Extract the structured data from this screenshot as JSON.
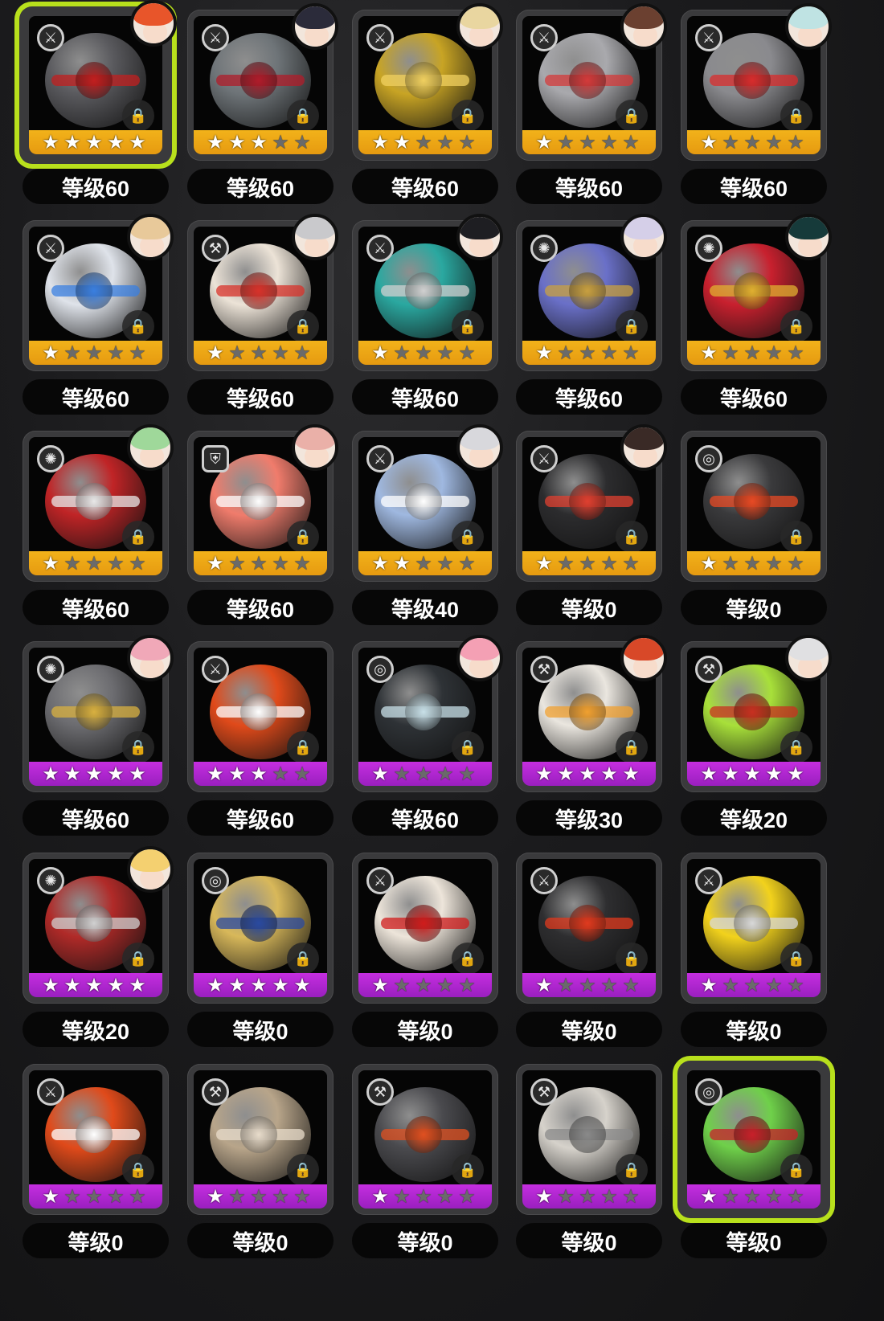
{
  "colors": {
    "gold": "#f2b21a",
    "purple": "#c52ee0",
    "selected": "#b8e01c"
  },
  "icons": {
    "lock": "lock-icon",
    "star": "star-icon"
  },
  "items": [
    {
      "level": "等级60",
      "stars": 5,
      "rarity": "gold",
      "type": "attack",
      "selected": true,
      "avatar": true,
      "avatar_hair": "#e8552a",
      "engine": "#5a5a5e",
      "accent": "#c21f1f"
    },
    {
      "level": "等级60",
      "stars": 3,
      "rarity": "gold",
      "type": "attack",
      "selected": false,
      "avatar": true,
      "avatar_hair": "#2b2b3a",
      "engine": "#6e7478",
      "accent": "#b01c2a"
    },
    {
      "level": "等级60",
      "stars": 2,
      "rarity": "gold",
      "type": "attack",
      "selected": false,
      "avatar": true,
      "avatar_hair": "#e9d6a0",
      "engine": "#c8a424",
      "accent": "#f0d060"
    },
    {
      "level": "等级60",
      "stars": 1,
      "rarity": "gold",
      "type": "attack",
      "selected": false,
      "avatar": true,
      "avatar_hair": "#6b4030",
      "engine": "#a9a9ad",
      "accent": "#d43a3a"
    },
    {
      "level": "等级60",
      "stars": 1,
      "rarity": "gold",
      "type": "attack",
      "selected": false,
      "avatar": true,
      "avatar_hair": "#bfe3e3",
      "engine": "#8a8a8e",
      "accent": "#d92c2c"
    },
    {
      "level": "等级60",
      "stars": 1,
      "rarity": "gold",
      "type": "attack",
      "selected": false,
      "avatar": true,
      "avatar_hair": "#e8c99a",
      "engine": "#dfe3ea",
      "accent": "#3a7fe0"
    },
    {
      "level": "等级60",
      "stars": 1,
      "rarity": "gold",
      "type": "stun",
      "selected": false,
      "avatar": true,
      "avatar_hair": "#c9c9cc",
      "engine": "#ece3d7",
      "accent": "#d8322a"
    },
    {
      "level": "等级60",
      "stars": 1,
      "rarity": "gold",
      "type": "attack",
      "selected": false,
      "avatar": true,
      "avatar_hair": "#1e1e22",
      "engine": "#2aa8a0",
      "accent": "#d0d0d0"
    },
    {
      "level": "等级60",
      "stars": 1,
      "rarity": "gold",
      "type": "anomaly",
      "selected": false,
      "avatar": true,
      "avatar_hair": "#d5cfe8",
      "engine": "#6a70c8",
      "accent": "#c8a040"
    },
    {
      "level": "等级60",
      "stars": 1,
      "rarity": "gold",
      "type": "anomaly",
      "selected": false,
      "avatar": true,
      "avatar_hair": "#163a3a",
      "engine": "#c8202e",
      "accent": "#e0b030"
    },
    {
      "level": "等级60",
      "stars": 1,
      "rarity": "gold",
      "type": "anomaly",
      "selected": false,
      "avatar": true,
      "avatar_hair": "#9fd89a",
      "engine": "#c02426",
      "accent": "#e8e8e8"
    },
    {
      "level": "等级60",
      "stars": 1,
      "rarity": "gold",
      "type": "defense",
      "selected": false,
      "avatar": true,
      "avatar_hair": "#eab0a8",
      "engine": "#f07c6c",
      "accent": "#ffffff"
    },
    {
      "level": "等级40",
      "stars": 2,
      "rarity": "gold",
      "type": "attack",
      "selected": false,
      "avatar": true,
      "avatar_hair": "#d8d8dc",
      "engine": "#9fb8e0",
      "accent": "#ffffff"
    },
    {
      "level": "等级0",
      "stars": 1,
      "rarity": "gold",
      "type": "attack",
      "selected": false,
      "avatar": true,
      "avatar_hair": "#3a2a26",
      "engine": "#2c2c2e",
      "accent": "#e04030"
    },
    {
      "level": "等级0",
      "stars": 1,
      "rarity": "gold",
      "type": "support",
      "selected": false,
      "avatar": false,
      "avatar_hair": "",
      "engine": "#3a3a3c",
      "accent": "#e84a24"
    },
    {
      "level": "等级60",
      "stars": 5,
      "rarity": "purple",
      "type": "anomaly",
      "selected": false,
      "avatar": true,
      "avatar_hair": "#f0a8b8",
      "engine": "#6c6c70",
      "accent": "#d8b040"
    },
    {
      "level": "等级60",
      "stars": 3,
      "rarity": "purple",
      "type": "attack",
      "selected": false,
      "avatar": false,
      "avatar_hair": "",
      "engine": "#e04a1a",
      "accent": "#ffffff"
    },
    {
      "level": "等级60",
      "stars": 1,
      "rarity": "purple",
      "type": "support",
      "selected": false,
      "avatar": true,
      "avatar_hair": "#f4a0b4",
      "engine": "#2e3236",
      "accent": "#c8e0e8"
    },
    {
      "level": "等级30",
      "stars": 5,
      "rarity": "purple",
      "type": "stun",
      "selected": false,
      "avatar": true,
      "avatar_hair": "#d84828",
      "engine": "#eae6df",
      "accent": "#f0a030"
    },
    {
      "level": "等级20",
      "stars": 5,
      "rarity": "purple",
      "type": "stun",
      "selected": false,
      "avatar": true,
      "avatar_hair": "#e0e0e2",
      "engine": "#a8e03a",
      "accent": "#c83020"
    },
    {
      "level": "等级20",
      "stars": 5,
      "rarity": "purple",
      "type": "anomaly",
      "selected": false,
      "avatar": true,
      "avatar_hair": "#f4d070",
      "engine": "#b02a28",
      "accent": "#d0d0d0"
    },
    {
      "level": "等级0",
      "stars": 5,
      "rarity": "purple",
      "type": "support",
      "selected": false,
      "avatar": false,
      "avatar_hair": "",
      "engine": "#d8b85a",
      "accent": "#2a4aa0"
    },
    {
      "level": "等级0",
      "stars": 1,
      "rarity": "purple",
      "type": "attack",
      "selected": false,
      "avatar": false,
      "avatar_hair": "",
      "engine": "#ede5da",
      "accent": "#d01c1c"
    },
    {
      "level": "等级0",
      "stars": 1,
      "rarity": "purple",
      "type": "attack",
      "selected": false,
      "avatar": false,
      "avatar_hair": "",
      "engine": "#2e2e30",
      "accent": "#e03a1e"
    },
    {
      "level": "等级0",
      "stars": 1,
      "rarity": "purple",
      "type": "attack",
      "selected": false,
      "avatar": false,
      "avatar_hair": "",
      "engine": "#f2d21c",
      "accent": "#d8d8d8"
    },
    {
      "level": "等级0",
      "stars": 1,
      "rarity": "purple",
      "type": "attack",
      "selected": false,
      "avatar": false,
      "avatar_hair": "",
      "engine": "#e04a1a",
      "accent": "#ffffff"
    },
    {
      "level": "等级0",
      "stars": 1,
      "rarity": "purple",
      "type": "stun",
      "selected": false,
      "avatar": false,
      "avatar_hair": "",
      "engine": "#b8a58a",
      "accent": "#e8dccb"
    },
    {
      "level": "等级0",
      "stars": 1,
      "rarity": "purple",
      "type": "stun",
      "selected": false,
      "avatar": false,
      "avatar_hair": "",
      "engine": "#4a4a4e",
      "accent": "#e05020"
    },
    {
      "level": "等级0",
      "stars": 1,
      "rarity": "purple",
      "type": "stun",
      "selected": false,
      "avatar": false,
      "avatar_hair": "",
      "engine": "#d6d2cb",
      "accent": "#8a8a8a"
    },
    {
      "level": "等级0",
      "stars": 1,
      "rarity": "purple",
      "type": "support",
      "selected": true,
      "avatar": false,
      "avatar_hair": "",
      "engine": "#6fd04a",
      "accent": "#c8202a"
    }
  ]
}
